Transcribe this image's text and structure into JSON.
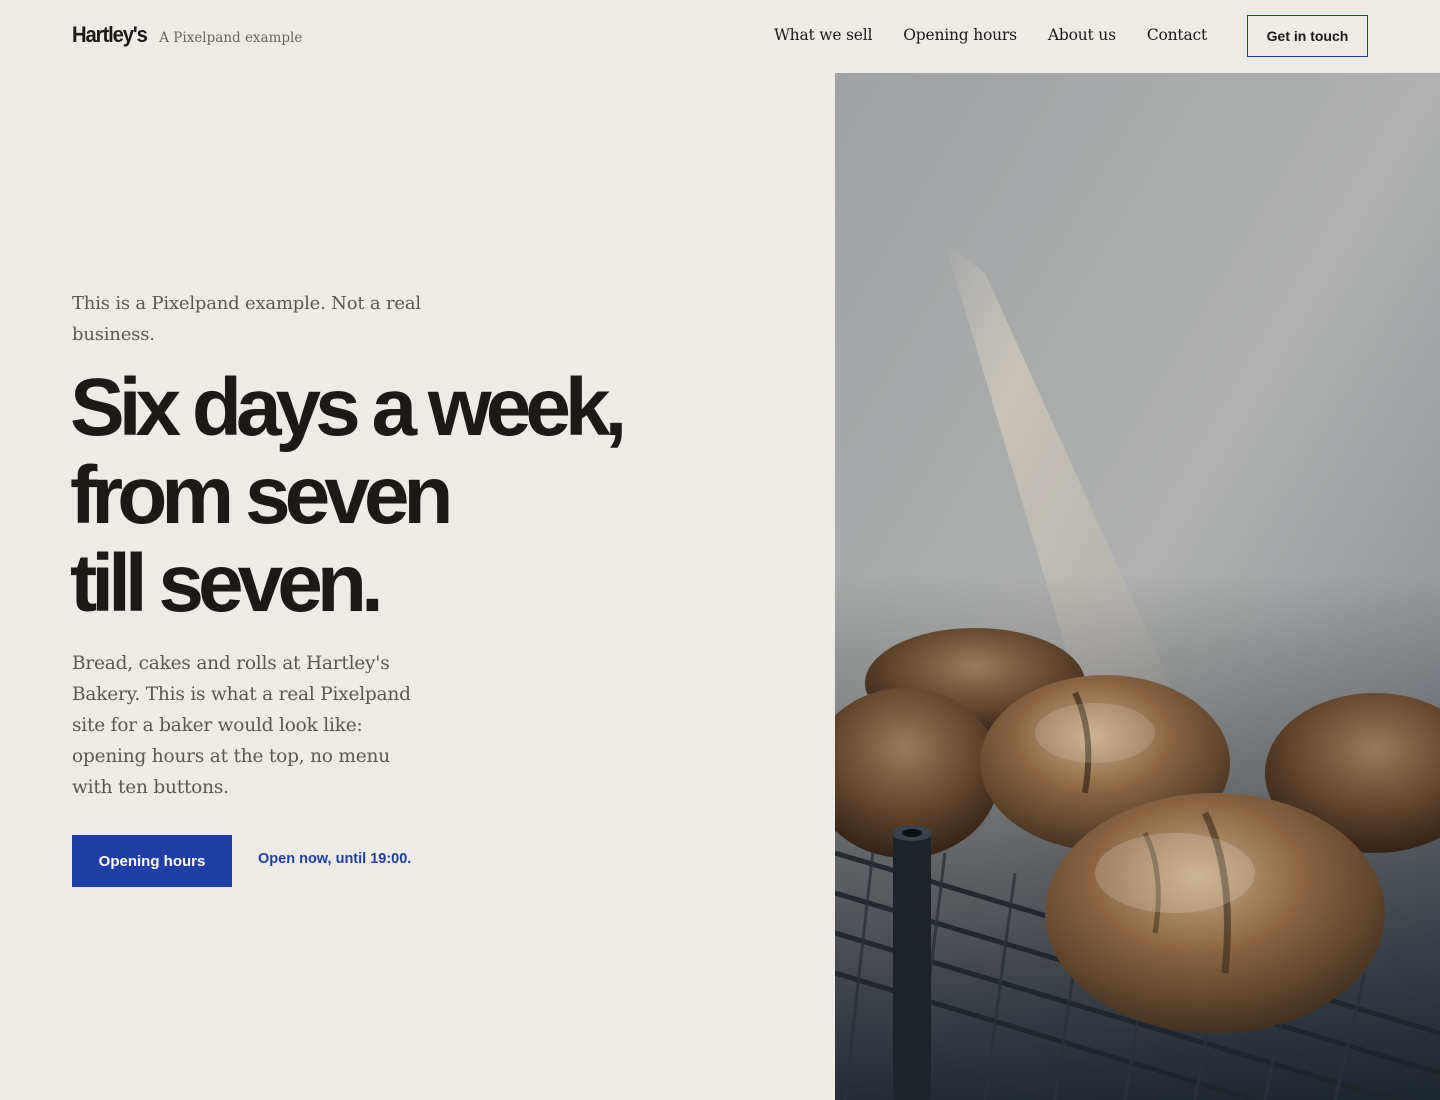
{
  "header": {
    "brand_name": "Hartley's",
    "brand_tagline": "A Pixelpand example",
    "nav": [
      {
        "label": "What we sell"
      },
      {
        "label": "Opening hours"
      },
      {
        "label": "About us"
      },
      {
        "label": "Contact"
      }
    ],
    "cta_label": "Get in touch"
  },
  "hero": {
    "eyebrow": "This is a Pixelpand example. Not a real business.",
    "headline_lines": [
      "Six days a week,",
      "from seven",
      "till seven."
    ],
    "body": "Bread, cakes and rolls at Hartley's Bakery. This is what a real Pixelpand site for a baker would look like: opening hours at the top, no menu with ten buttons.",
    "primary_button": "Opening hours",
    "status_text": "Open now, until 19:00."
  },
  "image": {
    "icon": "bread-loaves-on-rack-photo"
  },
  "colors": {
    "background": "#edebe5",
    "accent": "#1f3ea8",
    "text": "#1c1a17",
    "muted_text": "#5c5850"
  }
}
